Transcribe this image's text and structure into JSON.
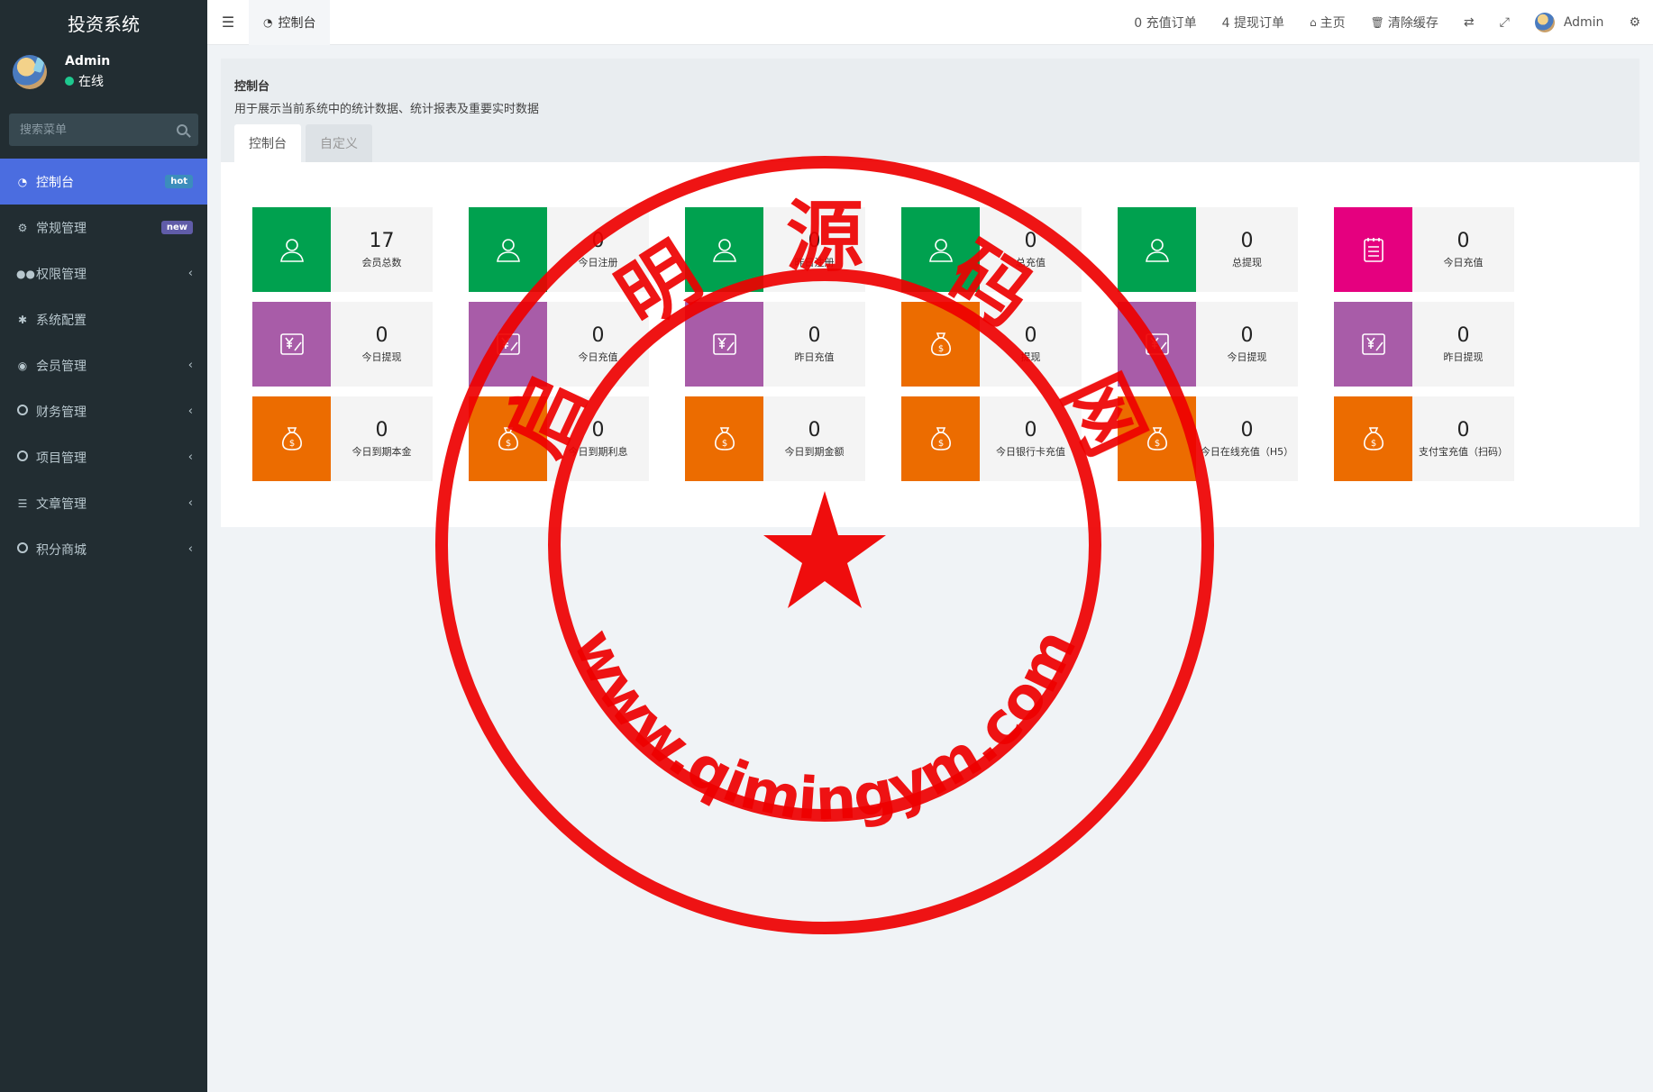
{
  "app": {
    "title": "投资系统"
  },
  "user": {
    "name": "Admin",
    "status": "在线"
  },
  "search": {
    "placeholder": "搜索菜单"
  },
  "menu": [
    {
      "label": "控制台",
      "icon": "dashboard-icon",
      "badge": "hot",
      "active": true
    },
    {
      "label": "常规管理",
      "icon": "cogs-icon",
      "badge": "new"
    },
    {
      "label": "权限管理",
      "icon": "users-icon",
      "chevron": true
    },
    {
      "label": "系统配置",
      "icon": "gear-icon"
    },
    {
      "label": "会员管理",
      "icon": "user-circle-icon",
      "chevron": true
    },
    {
      "label": "财务管理",
      "icon": "circle-icon",
      "chevron": true
    },
    {
      "label": "项目管理",
      "icon": "circle-icon",
      "chevron": true
    },
    {
      "label": "文章管理",
      "icon": "list-icon",
      "chevron": true
    },
    {
      "label": "积分商城",
      "icon": "circle-icon",
      "chevron": true
    }
  ],
  "header": {
    "tab": "控制台",
    "recharge_orders": "0 充值订单",
    "withdraw_orders": "4 提现订单",
    "home": "主页",
    "clear_cache": "清除缓存",
    "user": "Admin"
  },
  "content": {
    "title": "控制台",
    "description": "用于展示当前系统中的统计数据、统计报表及重要实时数据",
    "tabs": [
      "控制台",
      "自定义"
    ]
  },
  "stats": [
    {
      "value": "17",
      "label": "会员总数",
      "color": "#00a14f",
      "icon": "user-icon"
    },
    {
      "value": "0",
      "label": "今日注册",
      "color": "#00a14f",
      "icon": "user-icon"
    },
    {
      "value": "0",
      "label": "昨日注册",
      "color": "#00a14f",
      "icon": "user-icon"
    },
    {
      "value": "0",
      "label": "总充值",
      "color": "#00a14f",
      "icon": "user-icon"
    },
    {
      "value": "0",
      "label": "总提现",
      "color": "#00a14f",
      "icon": "user-icon"
    },
    {
      "value": "0",
      "label": "今日充值",
      "color": "#e5007f",
      "icon": "notepad-icon"
    },
    {
      "value": "0",
      "label": "今日提现",
      "color": "#a85ca8",
      "icon": "yen-icon"
    },
    {
      "value": "0",
      "label": "今日充值",
      "color": "#a85ca8",
      "icon": "yen-icon"
    },
    {
      "value": "0",
      "label": "昨日充值",
      "color": "#a85ca8",
      "icon": "yen-icon"
    },
    {
      "value": "0",
      "label": "提现",
      "color": "#ec6c00",
      "icon": "money-bag-icon"
    },
    {
      "value": "0",
      "label": "今日提现",
      "color": "#a85ca8",
      "icon": "yen-icon"
    },
    {
      "value": "0",
      "label": "昨日提现",
      "color": "#a85ca8",
      "icon": "yen-icon"
    },
    {
      "value": "0",
      "label": "今日到期本金",
      "color": "#ec6c00",
      "icon": "money-bag-icon"
    },
    {
      "value": "0",
      "label": "今日到期利息",
      "color": "#ec6c00",
      "icon": "money-bag-icon"
    },
    {
      "value": "0",
      "label": "今日到期金额",
      "color": "#ec6c00",
      "icon": "money-bag-icon"
    },
    {
      "value": "0",
      "label": "今日银行卡充值",
      "color": "#ec6c00",
      "icon": "money-bag-icon"
    },
    {
      "value": "0",
      "label": "今日在线充值（H5）",
      "color": "#ec6c00",
      "icon": "money-bag-icon"
    },
    {
      "value": "0",
      "label": "支付宝充值（扫码）",
      "color": "#ec6c00",
      "icon": "money-bag-icon"
    }
  ],
  "watermark": {
    "chars": [
      "启",
      "明",
      "源",
      "码",
      "网"
    ],
    "url": "www.qimingym.com"
  }
}
